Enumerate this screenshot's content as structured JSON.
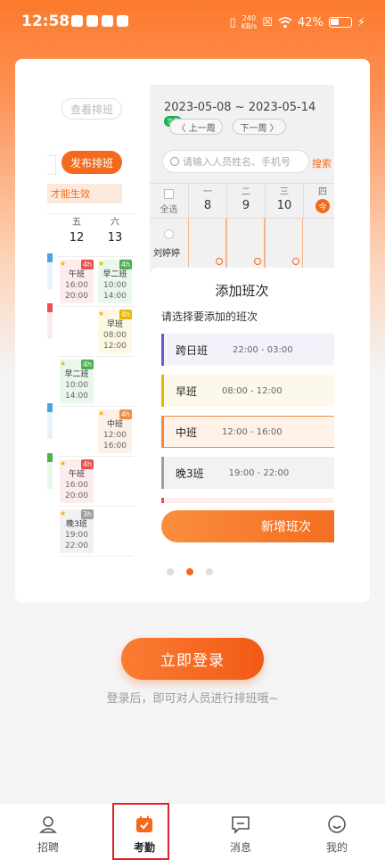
{
  "status_bar": {
    "time": "12:58",
    "net_speed_value": "240",
    "net_speed_unit": "KB/s",
    "battery": "42%",
    "battery_level": 0.42
  },
  "preview": {
    "view_schedule": "查看排班",
    "publish_schedule": "发布排班",
    "notice": "才能生效",
    "old_table": {
      "columns": [
        {
          "day": "五",
          "date": "12"
        },
        {
          "day": "六",
          "date": "13"
        }
      ],
      "col_fri": [
        {
          "name": "午班",
          "start": "16:00",
          "end": "20:00",
          "hours": "4h",
          "color": "#e9504e",
          "bg": "#fdecec"
        },
        null,
        {
          "name": "早二班",
          "start": "10:00",
          "end": "14:00",
          "hours": "4h",
          "color": "#4cb04f",
          "bg": "#ecf7ec"
        },
        null,
        {
          "name": "午班",
          "start": "16:00",
          "end": "20:00",
          "hours": "4h",
          "color": "#e9504e",
          "bg": "#fdecec"
        },
        {
          "name": "晚3班",
          "start": "19:00",
          "end": "22:00",
          "hours": "3h",
          "color": "#9e9e9e",
          "bg": "#f1f1f1"
        }
      ],
      "col_sat": [
        {
          "name": "早二班",
          "start": "10:00",
          "end": "14:00",
          "hours": "4h",
          "color": "#4cb04f",
          "bg": "#ecf7ec"
        },
        {
          "name": "早班",
          "start": "08:00",
          "end": "12:00",
          "hours": "4h",
          "color": "#e6b800",
          "bg": "#fdf8e3"
        },
        null,
        {
          "name": "中班",
          "start": "12:00",
          "end": "16:00",
          "hours": "4h",
          "color": "#f28b3c",
          "bg": "#fdf0e6"
        },
        null,
        null
      ]
    },
    "date_range": "2023-05-08 ~ 2023-05-14",
    "current_badge": "当周",
    "prev_week": "〈 上一周",
    "next_week": "下一周 〉",
    "search_placeholder": "请输入人员姓名、手机号",
    "search_button": "搜索",
    "select_all": "全选",
    "week_days": [
      {
        "day": "一",
        "date": "8"
      },
      {
        "day": "二",
        "date": "9"
      },
      {
        "day": "三",
        "date": "10"
      },
      {
        "day": "四",
        "date": "今"
      }
    ],
    "employee": "刘婷婷",
    "sheet_title": "添加班次",
    "sheet_prompt": "请选择要添加的班次",
    "shift_options": [
      {
        "name": "跨日班",
        "time": "22:00 - 03:00",
        "color": "#6a5acd",
        "bg": "#f3f2fb"
      },
      {
        "name": "早班",
        "time": "08:00 - 12:00",
        "color": "#e6b800",
        "bg": "#fdf9ea"
      },
      {
        "name": "中班",
        "time": "12:00 - 16:00",
        "color": "#f28b3c",
        "bg": "#fdf1e8"
      },
      {
        "name": "晚3班",
        "time": "19:00 - 22:00",
        "color": "#9e9e9e",
        "bg": "#f2f2f2"
      }
    ],
    "add_shift_button": "新增班次",
    "carousel_index": 2,
    "carousel_total": 3
  },
  "login_button": "立即登录",
  "login_hint": "登录后，即可对人员进行排班哦~",
  "tabs": [
    {
      "label": "招聘",
      "icon": "person-icon"
    },
    {
      "label": "考勤",
      "icon": "calendar-check-icon",
      "active": true
    },
    {
      "label": "消息",
      "icon": "message-icon"
    },
    {
      "label": "我的",
      "icon": "smile-icon"
    }
  ],
  "colors": {
    "accent": "#f36a1c",
    "highlight_box": "#e0202a"
  }
}
